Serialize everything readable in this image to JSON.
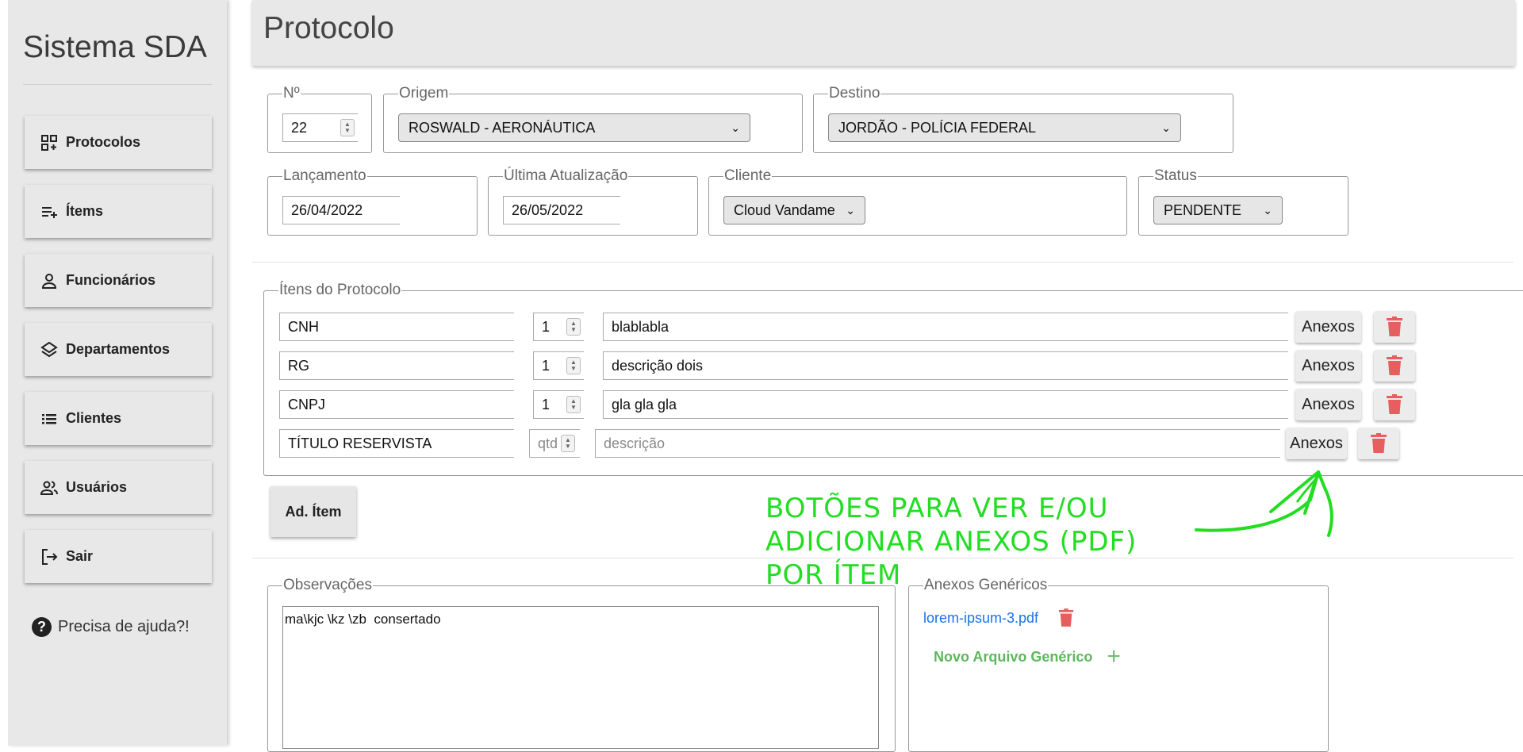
{
  "sidebar": {
    "brand": "Sistema SDA",
    "items": [
      {
        "label": "Protocolos",
        "icon": "dashboard-add-icon"
      },
      {
        "label": "Ítems",
        "icon": "playlist-add-icon"
      },
      {
        "label": "Funcionários",
        "icon": "person-icon"
      },
      {
        "label": "Departamentos",
        "icon": "layers-icon"
      },
      {
        "label": "Clientes",
        "icon": "list-icon"
      },
      {
        "label": "Usuários",
        "icon": "people-icon"
      },
      {
        "label": "Sair",
        "icon": "logout-icon"
      }
    ],
    "help": "Precisa de ajuda?!"
  },
  "header": {
    "title": "Protocolo"
  },
  "form": {
    "numero": {
      "legend": "Nº",
      "value": "22"
    },
    "origem": {
      "legend": "Origem",
      "value": "ROSWALD - AERONÁUTICA"
    },
    "destino": {
      "legend": "Destino",
      "value": "JORDÃO - POLÍCIA FEDERAL"
    },
    "lancamento": {
      "legend": "Lançamento",
      "value": "26/04/2022"
    },
    "ultima": {
      "legend": "Última Atualização",
      "value": "26/05/2022"
    },
    "cliente": {
      "legend": "Cliente",
      "value": "Cloud Vandame"
    },
    "status": {
      "legend": "Status",
      "value": "PENDENTE"
    }
  },
  "items": {
    "legend": "Ítens do Protocolo",
    "rows": [
      {
        "titulo": "CNH",
        "qtd": "1",
        "descricao": "blablabla"
      },
      {
        "titulo": "RG",
        "qtd": "1",
        "descricao": "descrição dois"
      },
      {
        "titulo": "CNPJ",
        "qtd": "1",
        "descricao": "gla gla gla"
      }
    ],
    "new_row": {
      "titulo": "TÍTULO RESERVISTA",
      "qtd_placeholder": "qtd",
      "descricao_placeholder": "descrição"
    },
    "anexos_label": "Anexos",
    "add_label": "Ad. Ítem"
  },
  "annotation": {
    "line1": "BOTÕES PARA VER E/OU",
    "line2": "ADICIONAR ANEXOS (PDF)",
    "line3": "POR ÍTEM",
    "color": "#22dd22"
  },
  "observacoes": {
    "legend": "Observações",
    "value": "ma\\kjc \\kz \\zb  consertado"
  },
  "anexos_genericos": {
    "legend": "Anexos Genéricos",
    "files": [
      "lorem-ipsum-3.pdf"
    ],
    "new_label": "Novo Arquivo Genérico"
  },
  "colors": {
    "delete": "#e85d5d",
    "link": "#1a73e8",
    "add_green": "#5cb85c"
  }
}
